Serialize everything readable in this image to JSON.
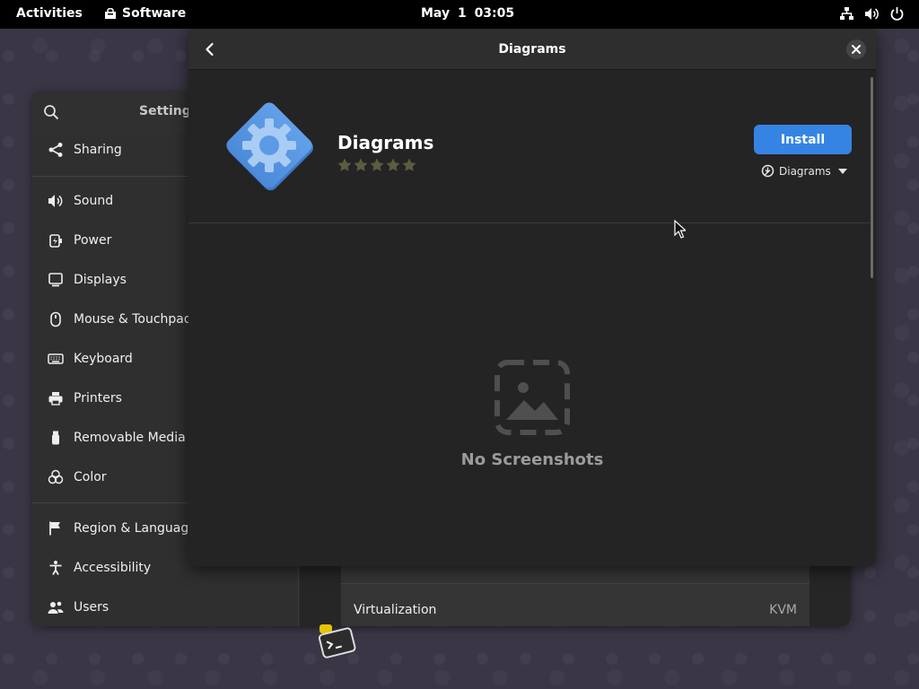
{
  "topbar": {
    "activities": "Activities",
    "app_name": "Software",
    "clock": "May 1  03:05",
    "tray_icons": [
      "network-icon",
      "volume-icon",
      "power-icon"
    ]
  },
  "settings": {
    "title": "Settings",
    "sidebar": [
      {
        "label": "Sharing",
        "icon": "share-icon"
      },
      {
        "label": "Sound",
        "icon": "sound-icon"
      },
      {
        "label": "Power",
        "icon": "power-plug-icon"
      },
      {
        "label": "Displays",
        "icon": "display-icon"
      },
      {
        "label": "Mouse & Touchpad",
        "icon": "mouse-icon"
      },
      {
        "label": "Keyboard",
        "icon": "keyboard-icon"
      },
      {
        "label": "Printers",
        "icon": "printer-icon"
      },
      {
        "label": "Removable Media",
        "icon": "usb-icon"
      },
      {
        "label": "Color",
        "icon": "color-icon"
      },
      {
        "label": "Region & Language",
        "icon": "flag-icon"
      },
      {
        "label": "Accessibility",
        "icon": "accessibility-icon"
      },
      {
        "label": "Users",
        "icon": "users-icon"
      }
    ],
    "detail_row": {
      "label": "Virtualization",
      "value": "KVM"
    }
  },
  "dialog": {
    "title": "Diagrams",
    "app": {
      "name": "Diagrams",
      "rating_stars": 0,
      "rating_max": 5,
      "install_label": "Install",
      "source_label": "Diagrams"
    },
    "screenshots_placeholder": "No Screenshots"
  },
  "colors": {
    "accent": "#3584e4",
    "app_icon": "#5c9ae6",
    "dialog_bg": "#242424",
    "star_empty": "#5e5c3f"
  }
}
